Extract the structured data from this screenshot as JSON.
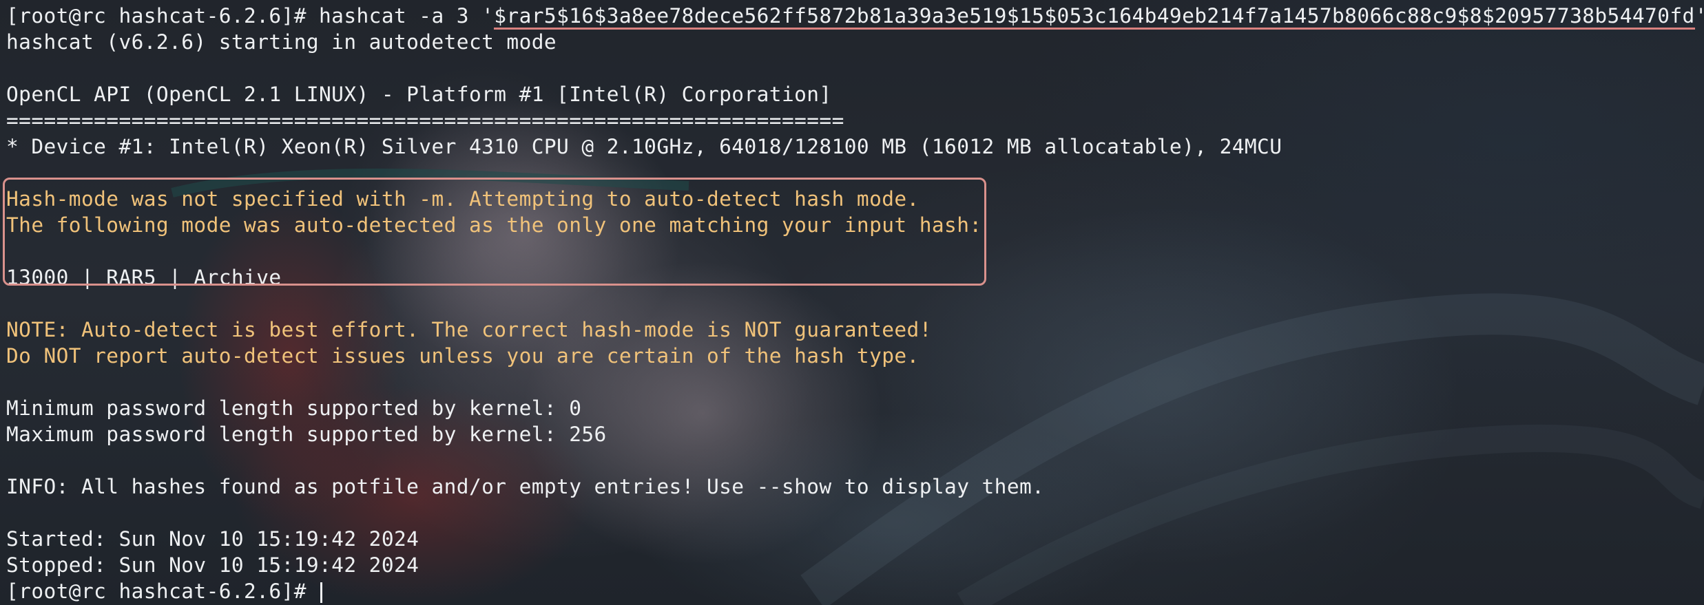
{
  "terminal": {
    "command": {
      "prompt": "[root@rc hashcat-6.2.6]# ",
      "cmd": "hashcat -a 3 '",
      "hash": "$rar5$16$3a8ee78dece562ff5872b81a39a3e519$15$053c164b49eb214f7a1457b8066c88c9$8$20957738b54470fd",
      "closing_quote": "'"
    },
    "lines": {
      "starting": "hashcat (v6.2.6) starting in autodetect mode",
      "opencl_api": "OpenCL API (OpenCL 2.1 LINUX) - Platform #1 [Intel(R) Corporation]",
      "separator": "===================================================================",
      "device": "* Device #1: Intel(R) Xeon(R) Silver 4310 CPU @ 2.10GHz, 64018/128100 MB (16012 MB allocatable), 24MCU",
      "hashmode_not_specified": "Hash-mode was not specified with -m. Attempting to auto-detect hash mode.",
      "following_mode": "The following mode was auto-detected as the only one matching your input hash:",
      "detected_mode": "13000 | RAR5 | Archive",
      "note": "NOTE: Auto-detect is best effort. The correct hash-mode is NOT guaranteed!",
      "do_not_report": "Do NOT report auto-detect issues unless you are certain of the hash type.",
      "min_password": "Minimum password length supported by kernel: 0",
      "max_password": "Maximum password length supported by kernel: 256",
      "info": "INFO: All hashes found as potfile and/or empty entries! Use --show to display them.",
      "started": "Started: Sun Nov 10 15:19:42 2024",
      "stopped": "Stopped: Sun Nov 10 15:19:42 2024",
      "final_prompt": "[root@rc hashcat-6.2.6]# "
    }
  },
  "colors": {
    "background": "#22262d",
    "text": "#eef0f2",
    "warning_text": "#f0c27a",
    "annotation": "#d9918c"
  }
}
